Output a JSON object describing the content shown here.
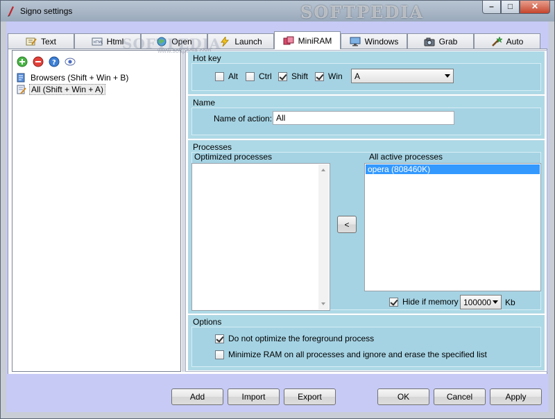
{
  "window": {
    "title": "Signo settings"
  },
  "watermarks": {
    "main": "SOFTPEDIA",
    "tab_overlay": "SOFTPEDIA",
    "url": "www.softpedia.com"
  },
  "caption": {
    "minimize": "–",
    "maximize": "□",
    "close": "✕"
  },
  "tabs": [
    {
      "label": "Text",
      "icon": "text-icon"
    },
    {
      "label": "Html",
      "icon": "html-icon"
    },
    {
      "label": "Open",
      "icon": "globe-icon"
    },
    {
      "label": "Launch",
      "icon": "lightning-icon"
    },
    {
      "label": "MiniRAM",
      "icon": "ram-icon",
      "active": true
    },
    {
      "label": "Windows",
      "icon": "monitor-icon"
    },
    {
      "label": "Grab",
      "icon": "camera-icon"
    },
    {
      "label": "Auto",
      "icon": "magic-icon"
    }
  ],
  "left": {
    "tools": [
      "add-icon",
      "remove-icon",
      "help-icon",
      "view-icon"
    ],
    "items": [
      {
        "label": "Browsers (Shift + Win + B)"
      },
      {
        "label": "All (Shift + Win + A)",
        "selected": true
      }
    ]
  },
  "hotkey": {
    "title": "Hot key",
    "alt": {
      "label": "Alt",
      "checked": false
    },
    "ctrl": {
      "label": "Ctrl",
      "checked": false
    },
    "shift": {
      "label": "Shift",
      "checked": true
    },
    "win": {
      "label": "Win",
      "checked": true
    },
    "key": "A"
  },
  "name": {
    "title": "Name",
    "label": "Name of action:",
    "value": "All"
  },
  "processes": {
    "title": "Processes",
    "optimized_title": "Optimized processes",
    "active_title": "All active processes",
    "active": [
      "opera (808460K)"
    ],
    "move_label": "<",
    "hide_label": "Hide if memory <",
    "hide_checked": true,
    "memory_value": "100000",
    "memory_unit": "Kb"
  },
  "options": {
    "title": "Options",
    "fg": {
      "label": "Do not optimize the foreground process",
      "checked": true
    },
    "minall": {
      "label": "Minimize RAM on all processes and ignore and erase the specified list",
      "checked": false
    }
  },
  "buttons": {
    "add": "Add",
    "import": "Import",
    "export": "Export",
    "ok": "OK",
    "cancel": "Cancel",
    "apply": "Apply"
  }
}
